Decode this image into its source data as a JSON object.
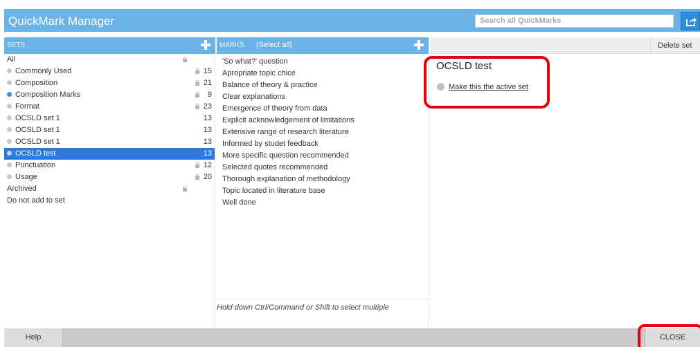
{
  "app": {
    "title": "QuickMark Manager"
  },
  "search": {
    "placeholder": "Search all QuickMarks"
  },
  "sets_header": {
    "label": "SETS"
  },
  "marks_header": {
    "label": "MARKS",
    "select_all": "(Select all)"
  },
  "detail_header": {
    "delete_set": "Delete set"
  },
  "sets": [
    {
      "label": "All",
      "count": "",
      "locked": true,
      "dot": "none",
      "selected": false
    },
    {
      "label": "Commonly Used",
      "count": "15",
      "locked": true,
      "dot": "grey",
      "selected": false
    },
    {
      "label": "Composition",
      "count": "21",
      "locked": true,
      "dot": "grey",
      "selected": false
    },
    {
      "label": "Composition Marks",
      "count": "9",
      "locked": true,
      "dot": "blue",
      "selected": false
    },
    {
      "label": "Format",
      "count": "23",
      "locked": true,
      "dot": "grey",
      "selected": false
    },
    {
      "label": "OCSLD set 1",
      "count": "13",
      "locked": false,
      "dot": "grey",
      "selected": false
    },
    {
      "label": "OCSLD set 1",
      "count": "13",
      "locked": false,
      "dot": "grey",
      "selected": false
    },
    {
      "label": "OCSLD set 1",
      "count": "13",
      "locked": false,
      "dot": "grey",
      "selected": false
    },
    {
      "label": "OCSLD test",
      "count": "13",
      "locked": false,
      "dot": "grey",
      "selected": true
    },
    {
      "label": "Punctuation",
      "count": "12",
      "locked": true,
      "dot": "grey",
      "selected": false
    },
    {
      "label": "Usage",
      "count": "20",
      "locked": true,
      "dot": "grey",
      "selected": false
    },
    {
      "label": "Archived",
      "count": "",
      "locked": true,
      "dot": "none",
      "selected": false
    },
    {
      "label": "Do not add to set",
      "count": "",
      "locked": false,
      "dot": "none",
      "selected": false
    }
  ],
  "marks": [
    "'So what?' question",
    "Apropriate topic chice",
    "Balance of theory & practice",
    "Clear explanations",
    "Emergence of theory from data",
    "Explicit acknowledgement of limitations",
    "Extensive range of research literature",
    "Informed by studet feedback",
    "More specific question recommended",
    "Selected quotes recommended",
    "Thorough explanation of methodology",
    "Topic located in literature base",
    "Well done"
  ],
  "marks_footer": "Hold down Ctrl/Command or Shift to select multiple",
  "detail": {
    "title": "OCSLD test",
    "active_link": "Make this the active set"
  },
  "footer": {
    "help": "Help",
    "close": "CLOSE"
  },
  "colors": {
    "header_blue": "#6bb3e6",
    "selected_blue": "#2f7ad9",
    "highlight_red": "#e3000f"
  }
}
